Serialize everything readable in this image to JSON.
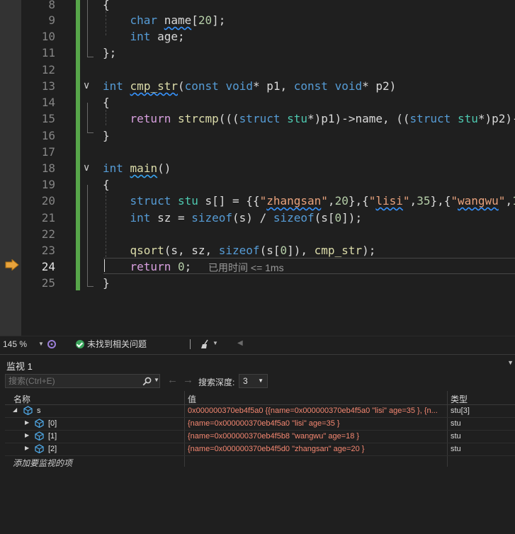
{
  "editor": {
    "lines": [
      {
        "num": "8"
      },
      {
        "num": "9"
      },
      {
        "num": "10"
      },
      {
        "num": "11"
      },
      {
        "num": "12"
      },
      {
        "num": "13"
      },
      {
        "num": "14"
      },
      {
        "num": "15"
      },
      {
        "num": "16"
      },
      {
        "num": "17"
      },
      {
        "num": "18"
      },
      {
        "num": "19"
      },
      {
        "num": "20"
      },
      {
        "num": "21"
      },
      {
        "num": "22"
      },
      {
        "num": "23"
      },
      {
        "num": "24"
      },
      {
        "num": "25"
      }
    ],
    "timing_hint": "已用时间 <= 1ms",
    "fold_symbol": "∨"
  },
  "status": {
    "zoom": "145 %",
    "issues": "未找到相关问题"
  },
  "watch": {
    "title": "监视 1",
    "search_placeholder": "搜索(Ctrl+E)",
    "depth_label": "搜索深度:",
    "depth_value": "3",
    "columns": {
      "name": "名称",
      "value": "值",
      "type": "类型"
    },
    "rows": [
      {
        "name": "s",
        "value": "0x000000370eb4f5a0 {{name=0x000000370eb4f5a0 \"lisi\" age=35 }, {n...",
        "type": "stu[3]"
      },
      {
        "name": "[0]",
        "value": "{name=0x000000370eb4f5a0 \"lisi\" age=35 }",
        "type": "stu"
      },
      {
        "name": "[1]",
        "value": "{name=0x000000370eb4f5b8 \"wangwu\" age=18 }",
        "type": "stu"
      },
      {
        "name": "[2]",
        "value": "{name=0x000000370eb4f5d0 \"zhangsan\" age=20 }",
        "type": "stu"
      }
    ],
    "add_item": "添加要监视的项"
  },
  "colors": {
    "keyword": "#569cd6",
    "type": "#4ec9b0",
    "string": "#e8a27d",
    "changed_value": "#f48771",
    "change_bar": "#57a64a",
    "breakpoint_arrow": "#e8a33c"
  }
}
